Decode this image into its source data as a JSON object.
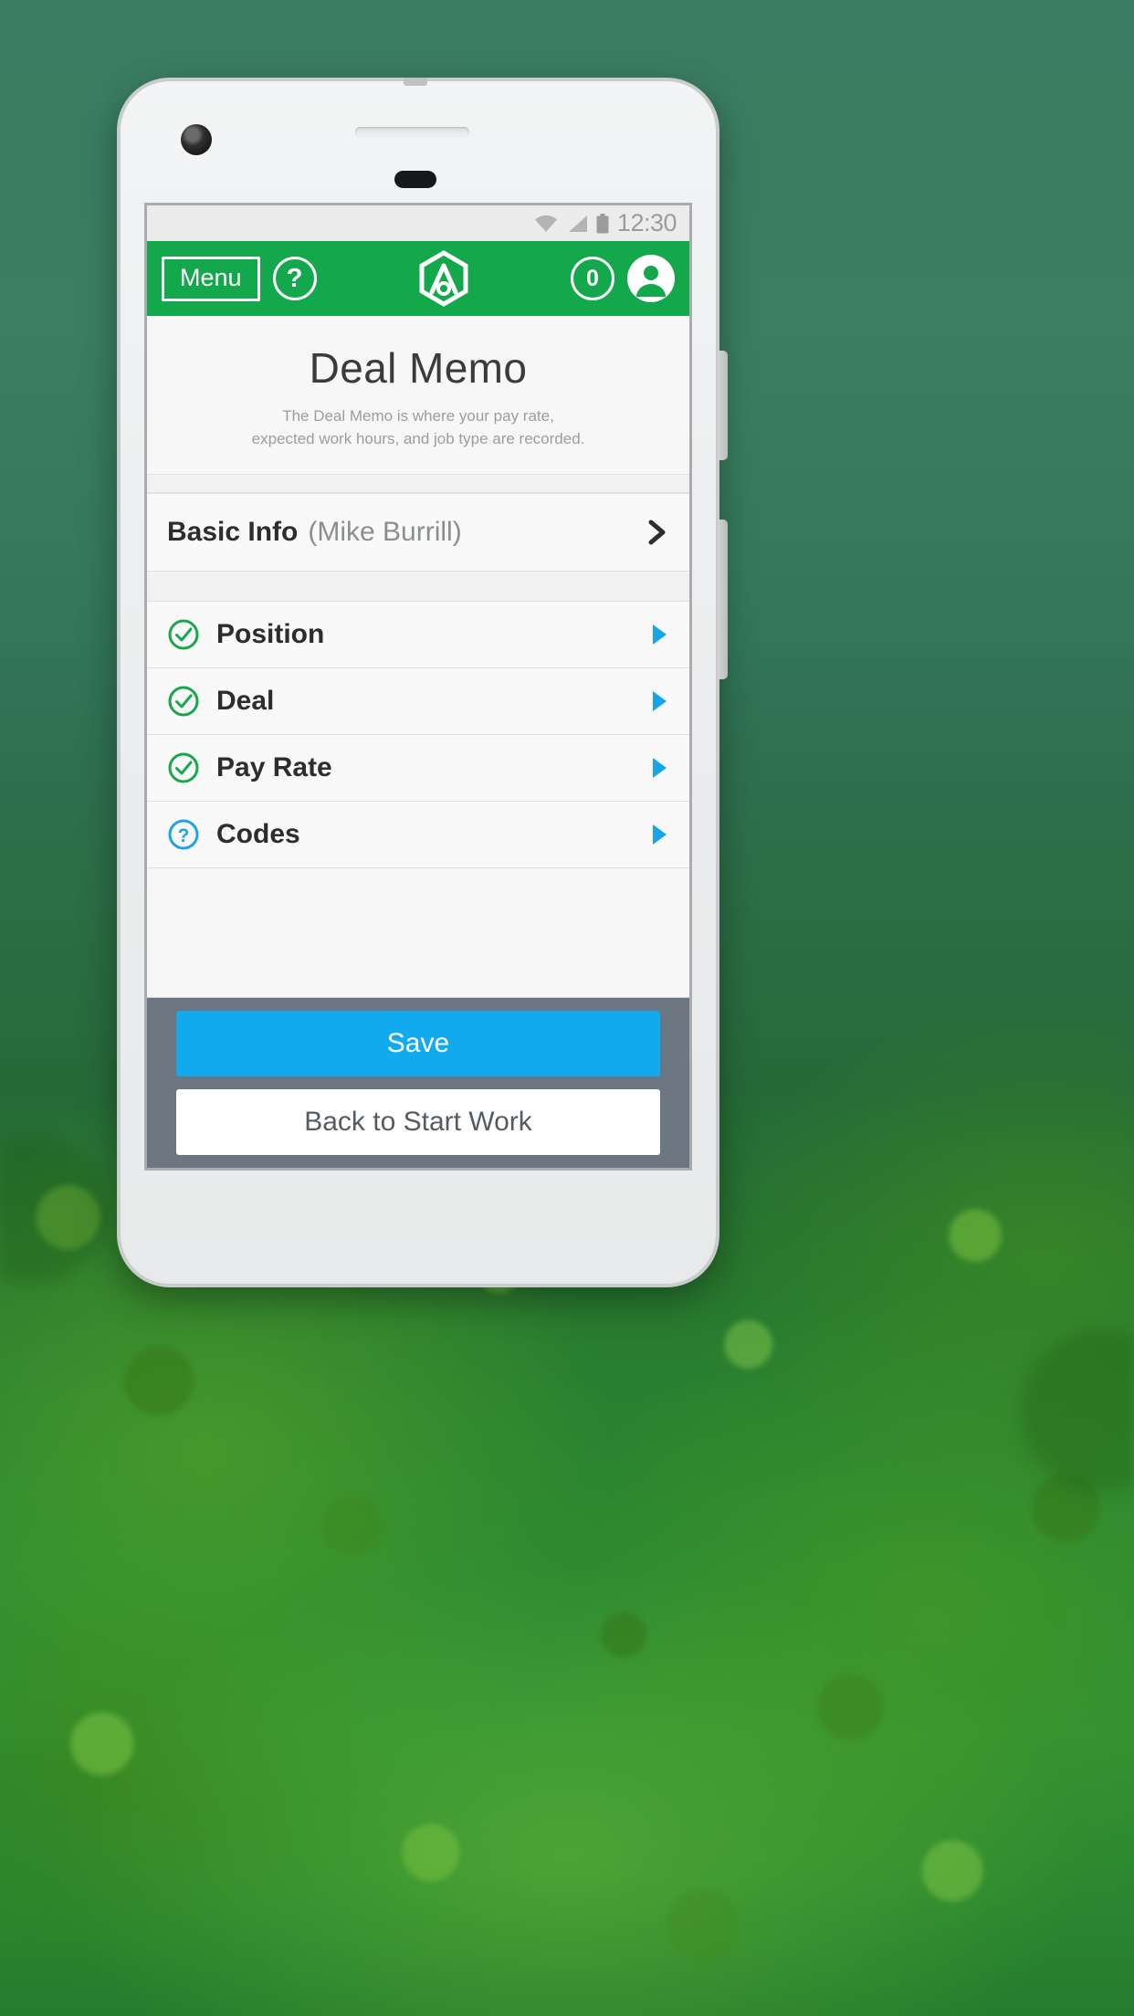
{
  "status_bar": {
    "time": "12:30",
    "icons": [
      "wifi-icon",
      "cell-signal-icon",
      "battery-icon"
    ]
  },
  "app_bar": {
    "menu_label": "Menu",
    "help_label": "?",
    "logo_name": "app-hexagon-logo",
    "notification_count": "0",
    "avatar_name": "user-avatar-icon",
    "background_color": "#12a84b"
  },
  "header": {
    "title": "Deal Memo",
    "subtitle": "The Deal Memo is where your pay rate,\nexpected work hours, and job type are recorded."
  },
  "basic_info": {
    "title": "Basic Info",
    "person": "(Mike Burrill)",
    "chevron": "chevron-right-icon"
  },
  "sections": [
    {
      "label": "Position",
      "status_icon": "check-circle-icon",
      "status_color": "#17a84c",
      "arrow": "triangle-right-icon"
    },
    {
      "label": "Deal",
      "status_icon": "check-circle-icon",
      "status_color": "#17a84c",
      "arrow": "triangle-right-icon"
    },
    {
      "label": "Pay Rate",
      "status_icon": "check-circle-icon",
      "status_color": "#17a84c",
      "arrow": "triangle-right-icon"
    },
    {
      "label": "Codes",
      "status_icon": "question-circle-icon",
      "status_color": "#1fa3e8",
      "arrow": "triangle-right-icon"
    }
  ],
  "actions": {
    "save_label": "Save",
    "save_color": "#12aaee",
    "back_label": "Back to Start Work",
    "bar_color": "#6b7681"
  },
  "nav_bar": {
    "back": "nav-back-icon",
    "home": "nav-home-icon",
    "recents": "nav-recents-icon"
  }
}
